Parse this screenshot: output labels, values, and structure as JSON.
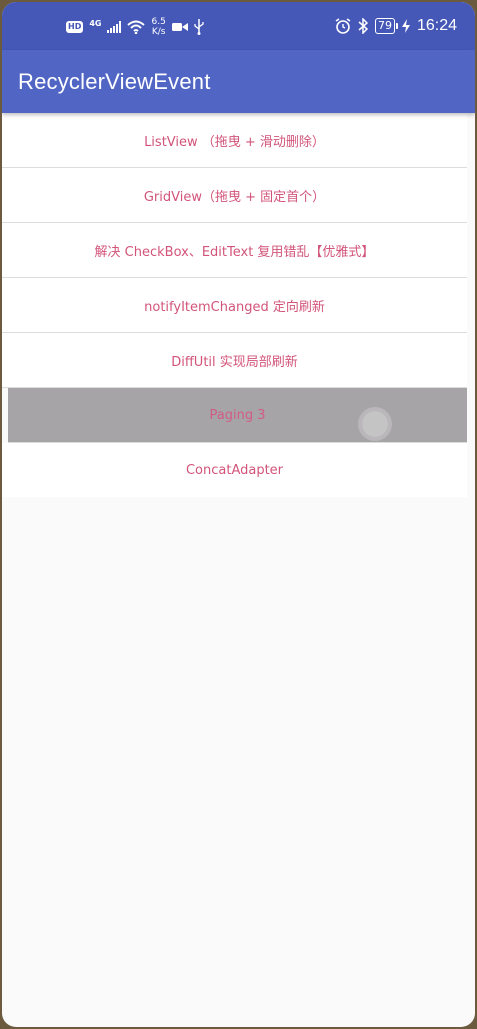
{
  "status_bar": {
    "hd": "HD",
    "network": "4G",
    "speed_value": "6.5",
    "speed_unit": "K/s",
    "battery": "79",
    "time": "16:24",
    "icons": [
      "signal-icon",
      "wifi-icon",
      "video-icon",
      "usb-icon",
      "alarm-icon",
      "bluetooth-icon",
      "battery-icon",
      "charging-icon"
    ]
  },
  "app_bar": {
    "title": "RecyclerViewEvent",
    "color": "#5166c4"
  },
  "list": {
    "accent_color": "#d2547a",
    "items": [
      {
        "label": "ListView （拖曳 + 滑动删除）"
      },
      {
        "label": "GridView（拖曳 + 固定首个）"
      },
      {
        "label": "解决 CheckBox、EditText 复用错乱【优雅式】"
      },
      {
        "label": "notifyItemChanged 定向刷新"
      },
      {
        "label": "DiffUtil 实现局部刷新"
      },
      {
        "label": "Paging 3"
      },
      {
        "label": "ConcatAdapter"
      }
    ]
  }
}
